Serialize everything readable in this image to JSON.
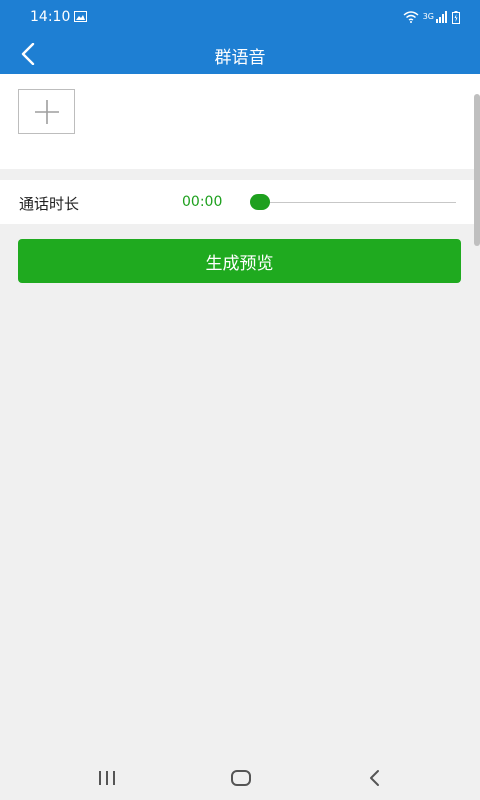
{
  "status_bar": {
    "time": "14:10",
    "network_label": "3G",
    "icons": [
      "gallery-icon",
      "wifi-icon",
      "signal-icon",
      "battery-icon"
    ]
  },
  "title_bar": {
    "title": "群语音",
    "back_icon": "chevron-left-icon"
  },
  "media": {
    "add_icon": "plus-icon"
  },
  "call_duration": {
    "label": "通话时长",
    "value": "00:00",
    "slider_level": 0
  },
  "actions": {
    "preview_label": "生成预览"
  },
  "nav_bar": {
    "icons": [
      "recent-apps-icon",
      "home-icon",
      "back-icon"
    ]
  },
  "colors": {
    "primary": "#1e7fd3",
    "accent_green": "#1faa1f",
    "background": "#f0f0f0"
  }
}
